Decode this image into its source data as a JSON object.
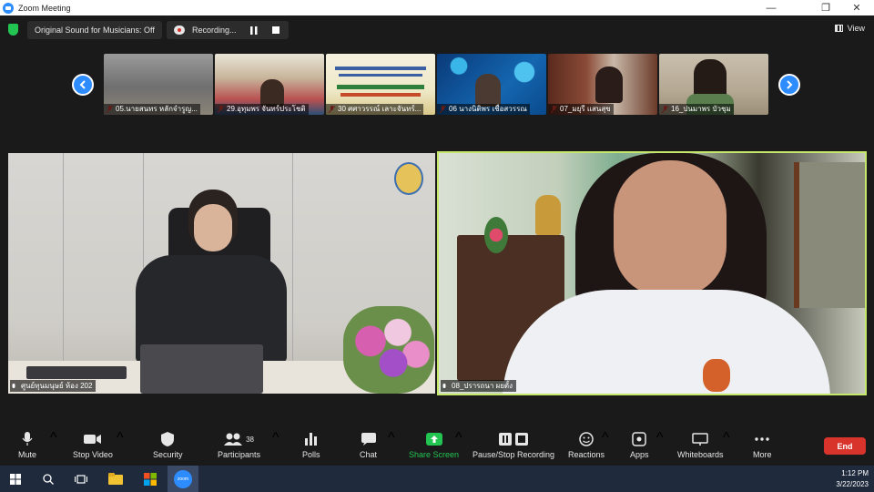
{
  "window": {
    "title": "Zoom Meeting"
  },
  "meeting_bar": {
    "sound_label": "Original Sound for Musicians: Off",
    "recording_label": "Recording...",
    "view_label": "View"
  },
  "strip": [
    {
      "name": "05.นายสนทร หลักจำรูญ..."
    },
    {
      "name": "29.อุทุมพร จันทร์ประโชติ"
    },
    {
      "name": "30 ศศาวรรณ์ เลาะจันทร์..."
    },
    {
      "name": "06 นางนิติพร เชื่อสวรรณ"
    },
    {
      "name": "07_มยุรี แสนสุข"
    },
    {
      "name": "16_ปนมาพร บัวชุม"
    }
  ],
  "main": {
    "left_name": "ศูนย์ทุนมนุษย์ ห้อง 202",
    "right_name": "08_ปรารถนา ผยตั้ง"
  },
  "toolbar": {
    "mute": "Mute",
    "stop_video": "Stop Video",
    "security": "Security",
    "participants": "Participants",
    "participants_count": "38",
    "polls": "Polls",
    "chat": "Chat",
    "share_screen": "Share Screen",
    "pause_recording": "Pause/Stop Recording",
    "reactions": "Reactions",
    "apps": "Apps",
    "whiteboards": "Whiteboards",
    "more": "More",
    "end": "End"
  },
  "taskbar": {
    "time": "1:12 PM",
    "date": "3/22/2023",
    "zoom_label": "zoom"
  },
  "colors": {
    "accent": "#2d8cff",
    "share_green": "#23c552",
    "end_red": "#d9342b",
    "active_speaker_border": "#c6e86a"
  }
}
